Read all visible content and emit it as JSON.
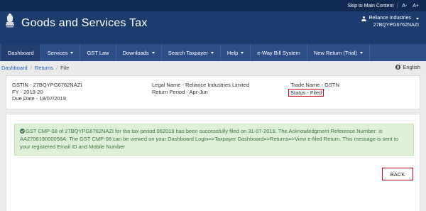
{
  "topbar": {
    "skip_label": "Skip to Main Content",
    "a_minus": "A-",
    "a_plus": "A+"
  },
  "header": {
    "title": "Goods and Services Tax",
    "user_name": "Reliance Industries",
    "user_gstin": "27BQYPG6762NAZI"
  },
  "nav": {
    "items": [
      {
        "label": "Dashboard",
        "dropdown": false
      },
      {
        "label": "Services",
        "dropdown": true
      },
      {
        "label": "GST Law",
        "dropdown": false
      },
      {
        "label": "Downloads",
        "dropdown": true
      },
      {
        "label": "Search Taxpayer",
        "dropdown": true
      },
      {
        "label": "Help",
        "dropdown": true
      },
      {
        "label": "e-Way Bill System",
        "dropdown": false
      },
      {
        "label": "New Return (Trial)",
        "dropdown": true
      }
    ]
  },
  "breadcrumb": {
    "items": [
      "Dashboard",
      "Returns"
    ],
    "current": "File",
    "language": "English"
  },
  "info": {
    "gstin": "GSTIN - 27BQYPG6762NAZI",
    "fy": "FY - 2019-20",
    "due_date": "Due Date - 18/07/2019",
    "legal_name": "Legal Name - Reliance Industries Limited",
    "return_period": "Return Period - Apr-Jun",
    "trade_name": "Trade Name - GSTN",
    "status": "Status - Filed"
  },
  "alert": {
    "message": "GST CMP-08 of 27BQYPG6762NAZI for the tax period 062019 has been successfully filed on 31-07-2019. The Acknowledgment Reference Number: is AA270619000058A. The GST CMP-08 can be viewed on your Dashboard Login=>Taxpayer Dashboard=>Returns=>View e-filed Return. This message is sent to your registered Email ID and Mobile Number"
  },
  "actions": {
    "back_label": "BACK"
  },
  "colors": {
    "header_bg": "#1b3d6e",
    "nav_bg": "#2c4e86",
    "highlight": "#d0021b",
    "alert_bg": "#dff0d8",
    "alert_text": "#3c763d"
  }
}
